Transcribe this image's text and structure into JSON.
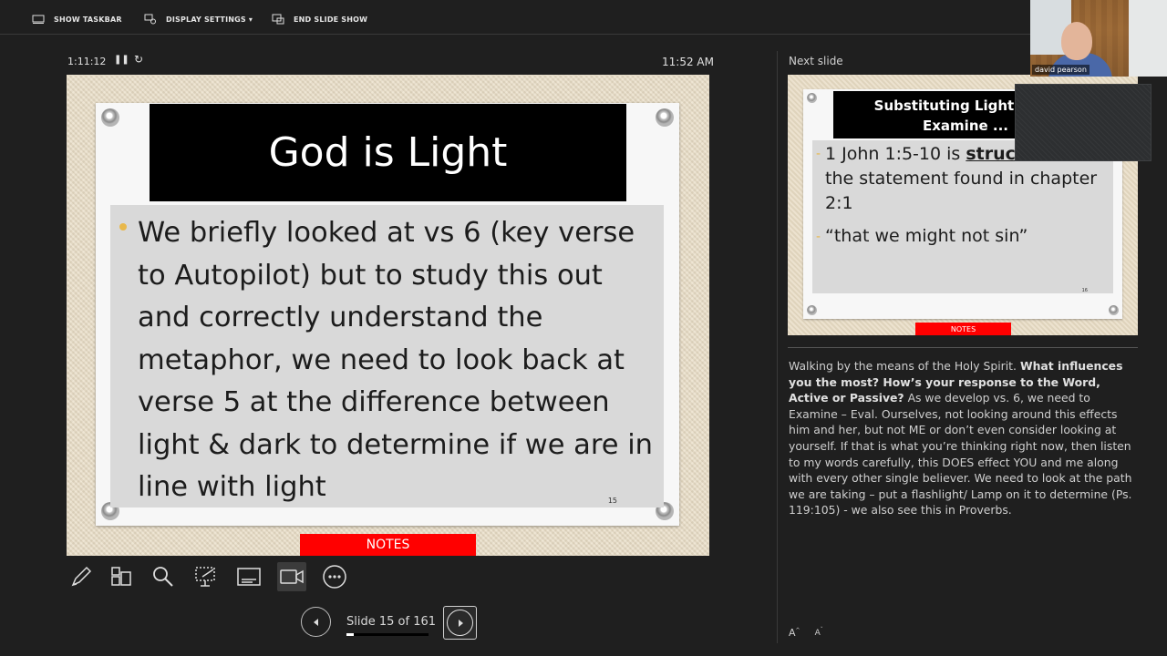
{
  "toolbar": {
    "show_taskbar": "SHOW TASKBAR",
    "display_settings": "DISPLAY SETTINGS ▾",
    "end_slide_show": "END SLIDE SHOW"
  },
  "timer": {
    "elapsed": "1:11:12",
    "clock": "11:52 AM"
  },
  "slide": {
    "title": "God is Light",
    "bullet": "We briefly looked at vs 6 (key verse to Autopilot) but to study this out and correctly understand the metaphor, we need to look back at verse 5 at the difference between light & dark to determine if we are in line with light",
    "number": "15",
    "notes_label": "NOTES"
  },
  "navigation": {
    "counter": "Slide 15 of 161",
    "progress": 0.093
  },
  "tools": [
    "pen-icon",
    "slides-grid-icon",
    "zoom-icon",
    "laser-pointer-icon",
    "subtitles-icon",
    "camera-icon",
    "more-options-icon"
  ],
  "next": {
    "label": "Next slide",
    "title_line1": "Substituting Light for D",
    "title_line2": "Examine ...",
    "line1_pre": "1 John 1:5-10 is ",
    "line1_bold": "struct",
    "line2": "the statement found in chapter",
    "line3": "2:1",
    "line4": "“that we might not sin”",
    "number": "16",
    "notes_label": "NOTES"
  },
  "notes": {
    "p1": "Walking by the means of the Holy Spirit.  ",
    "p2_bold": "What influences you the most?  How’s your response to the Word, Active or Passive?",
    "p3": "  As we develop vs. 6, we need to Examine – Eval. Ourselves, not looking around this effects him and her, but not ME or don’t even consider looking at yourself.  If that is what you’re thinking right now, then listen to my words carefully, this DOES effect YOU and me along with every other single believer. We need to look at the path we are taking – put a flashlight/ Lamp on it to determine (Ps. 119:105) -  we also see this in Proverbs."
  },
  "video": {
    "name": "david pearson"
  }
}
